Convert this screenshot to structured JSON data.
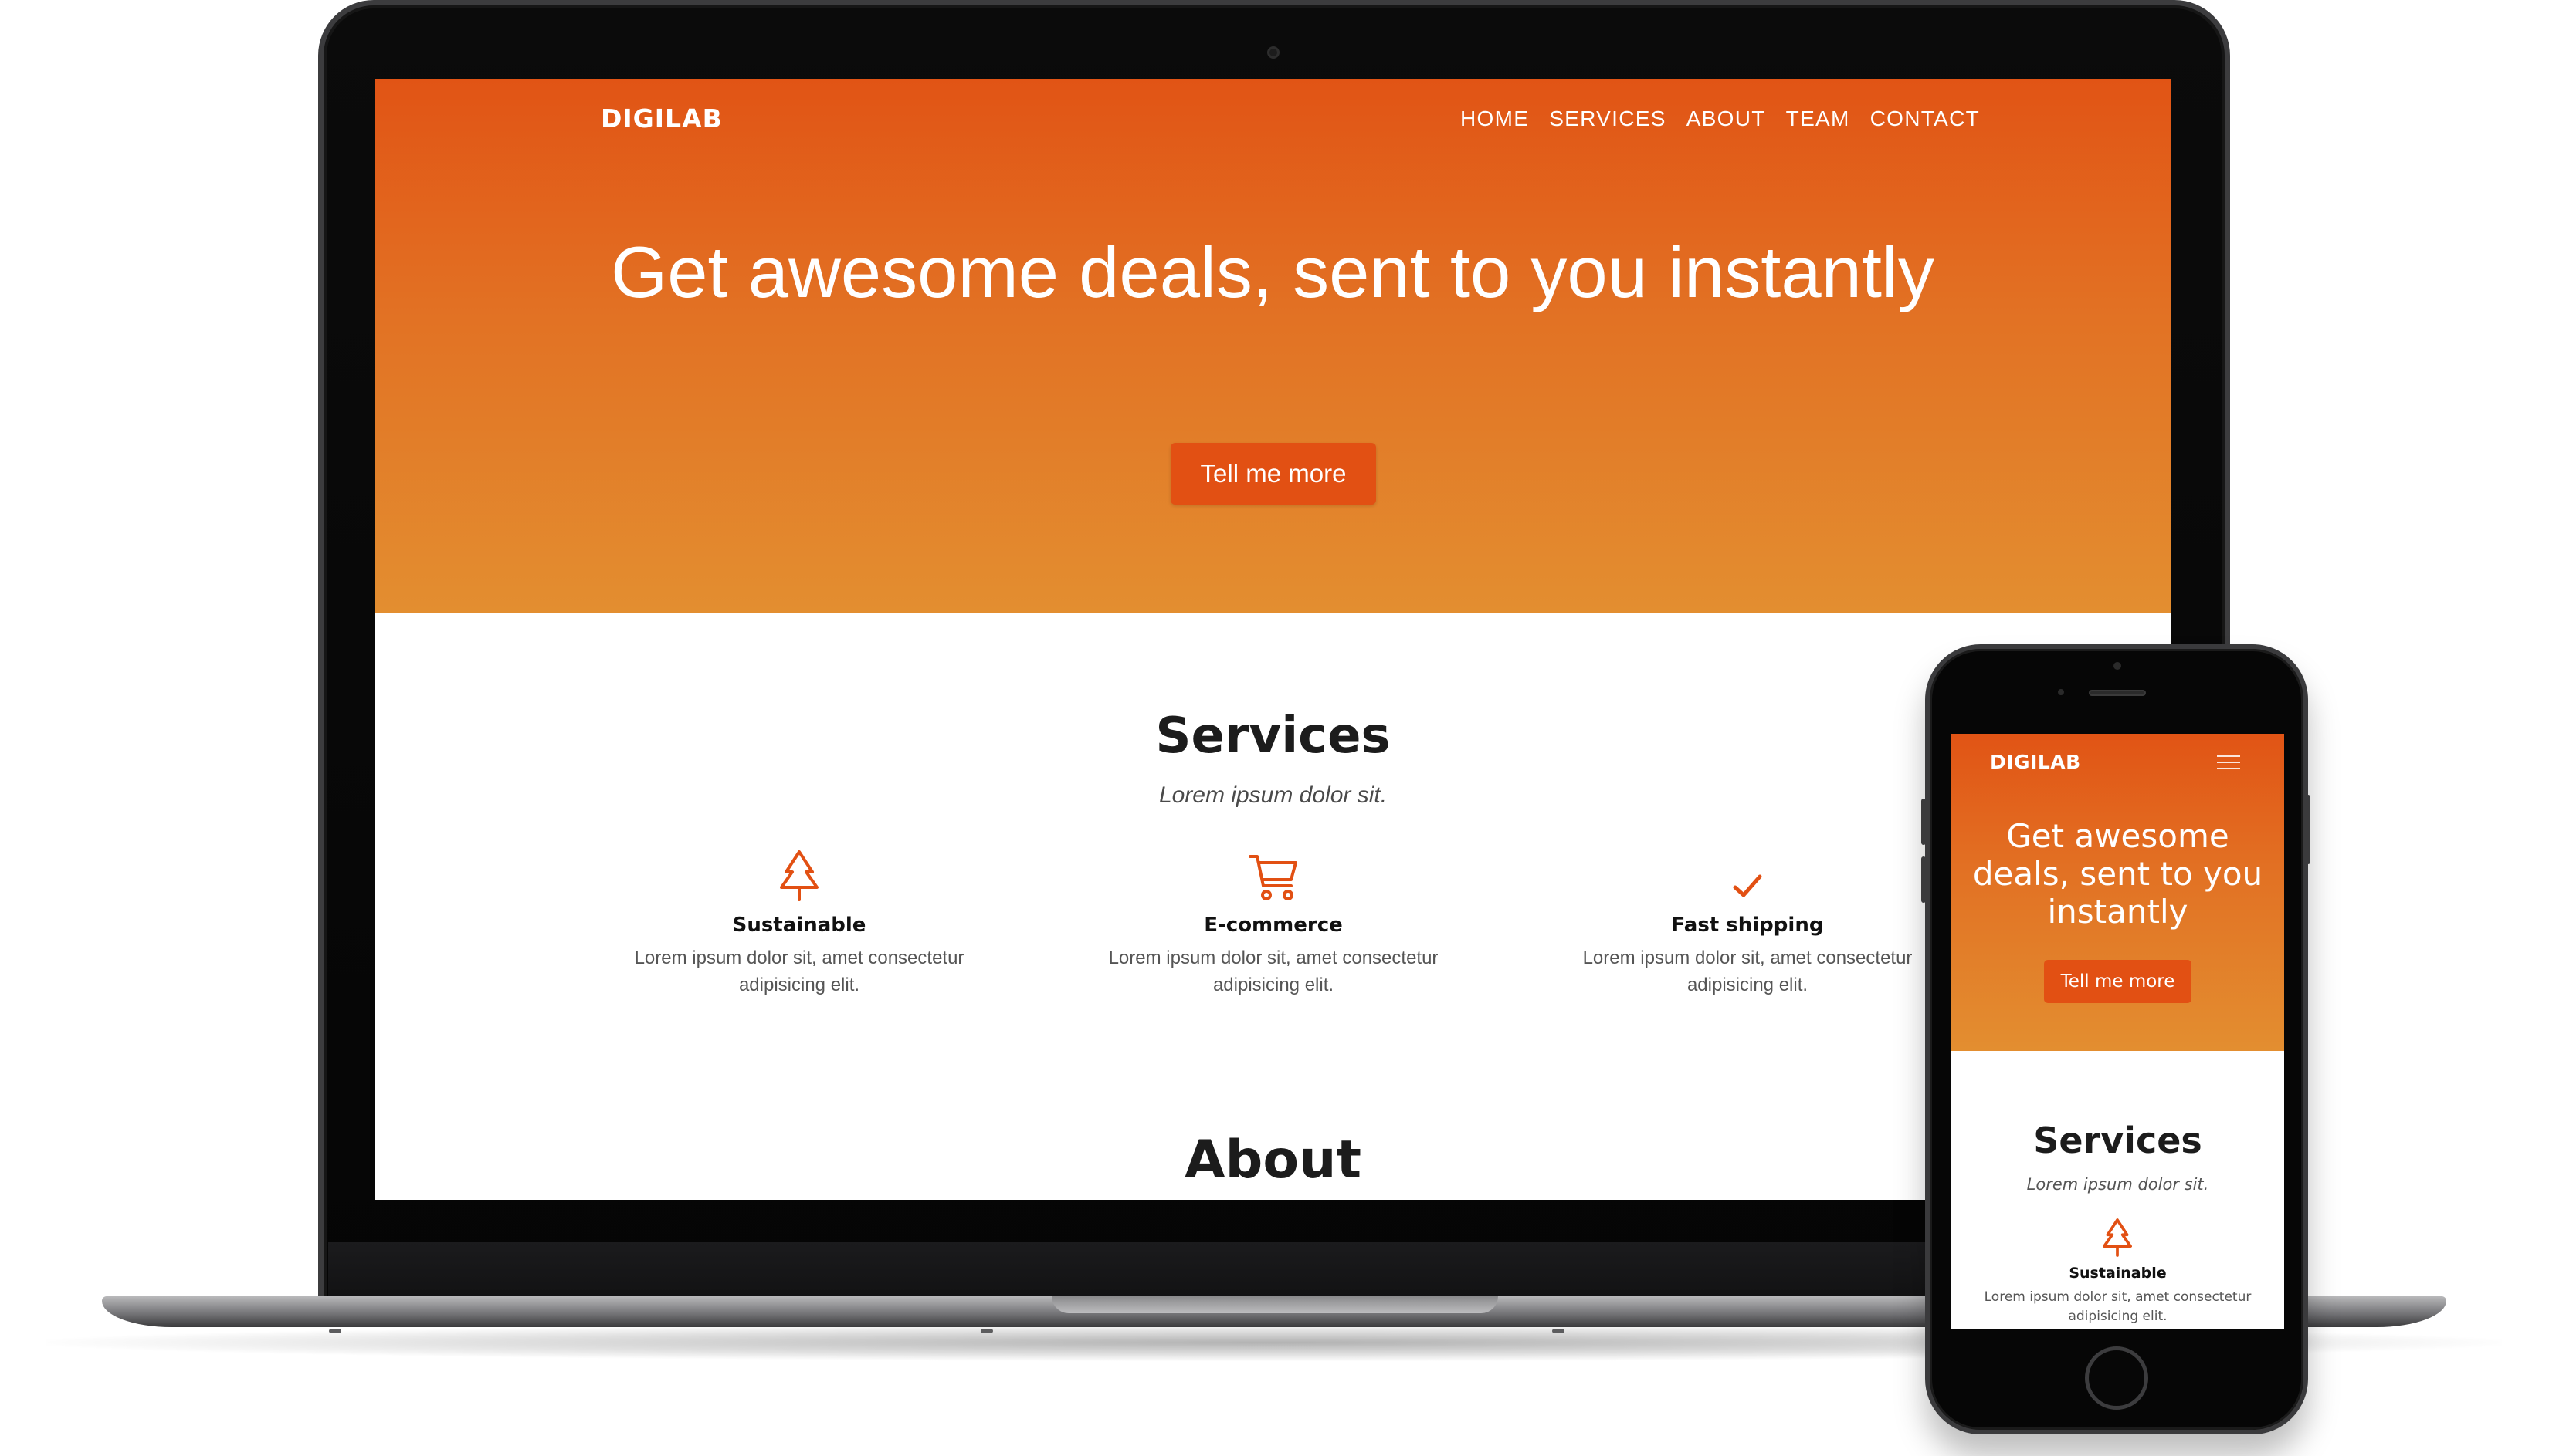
{
  "laptop": {
    "brand": "DIGILAB",
    "nav": [
      "HOME",
      "SERVICES",
      "ABOUT",
      "TEAM",
      "CONTACT"
    ],
    "hero": {
      "headline": "Get awesome deals, sent to you instantly",
      "cta": "Tell me more"
    },
    "services": {
      "title": "Services",
      "subtitle": "Lorem ipsum dolor sit.",
      "features": [
        {
          "icon": "tree-icon",
          "name": "Sustainable",
          "desc": "Lorem ipsum dolor sit, amet consectetur adipisicing elit."
        },
        {
          "icon": "cart-icon",
          "name": "E-commerce",
          "desc": "Lorem ipsum dolor sit, amet consectetur adipisicing elit."
        },
        {
          "icon": "check-icon",
          "name": "Fast shipping",
          "desc": "Lorem ipsum dolor sit, amet consectetur adipisicing elit."
        }
      ]
    },
    "about_title": "About"
  },
  "phone": {
    "brand": "DIGILAB",
    "menu_icon": "hamburger-menu-icon",
    "hero": {
      "headline": "Get awesome deals, sent to you instantly",
      "cta": "Tell me more"
    },
    "services": {
      "title": "Services",
      "subtitle": "Lorem ipsum dolor sit.",
      "feature": {
        "icon": "tree-icon",
        "name": "Sustainable",
        "desc": "Lorem ipsum dolor sit, amet consectetur adipisicing elit."
      }
    }
  },
  "colors": {
    "accent": "#e25013",
    "hero_top": "#e15415",
    "hero_bottom": "#e38e30",
    "heading": "#1c1c1c",
    "body_text": "#555555"
  }
}
